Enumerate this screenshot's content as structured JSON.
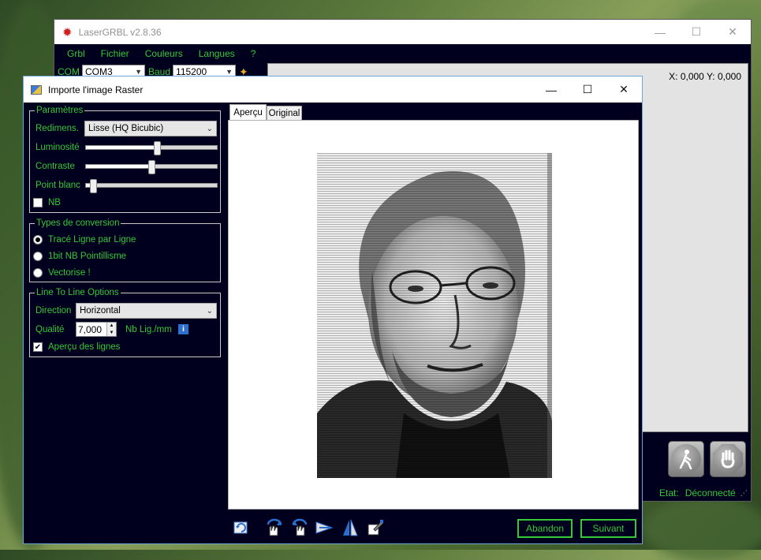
{
  "main_window": {
    "title": "LaserGRBL v2.8.36",
    "menu": [
      "Grbl",
      "Fichier",
      "Couleurs",
      "Langues",
      "?"
    ],
    "toolbar": {
      "com_label": "COM",
      "com_value": "COM3",
      "baud_label": "Baud",
      "baud_value": "115200"
    },
    "coords": "X: 0,000 Y: 0,000",
    "status_label": "Etat:",
    "status_value": "Déconnecté"
  },
  "dialog": {
    "title": "Importe l'image Raster",
    "params": {
      "legend": "Paramètres",
      "resize_label": "Redimens.",
      "resize_value": "Lisse (HQ Bicubic)",
      "brightness_label": "Luminosité",
      "brightness_level": 0.54,
      "contrast_label": "Contraste",
      "contrast_level": 0.5,
      "whitepoint_label": "Point blanc",
      "whitepoint_level": 0.06,
      "bw_label": "NB",
      "bw_checked": false
    },
    "conversion": {
      "legend": "Types de conversion",
      "options": [
        "Tracé Ligne par Ligne",
        "1bit NB Pointillisme",
        "Vectorise !"
      ],
      "selected_index": 0
    },
    "line_options": {
      "legend": "Line To Line Options",
      "direction_label": "Direction",
      "direction_value": "Horizontal",
      "quality_label": "Qualité",
      "quality_value": "7,000",
      "quality_unit": "Nb Lig./mm",
      "preview_lines_label": "Aperçu des lignes",
      "preview_lines_checked": true
    },
    "tabs": [
      "Aperçu",
      "Original"
    ],
    "active_tab": 0,
    "buttons": {
      "cancel": "Abandon",
      "next": "Suivant"
    }
  },
  "colors": {
    "background": "#00001e",
    "label_green": "#36c836"
  }
}
